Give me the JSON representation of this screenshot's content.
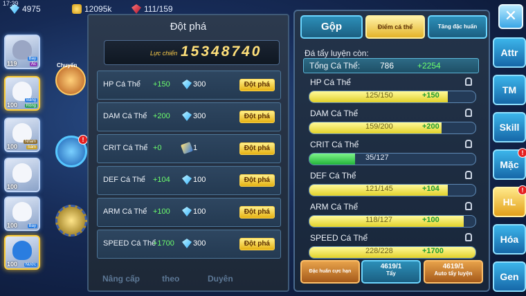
{
  "status_bar": {
    "clock": "17:39",
    "gems": "4975",
    "gold": "12095k",
    "ruby": "111/159"
  },
  "roster": [
    {
      "level": "119",
      "tag1": "Bay",
      "tag2": "Ác"
    },
    {
      "level": "100",
      "tag1": "Băng",
      "tag2": "Rồng"
    },
    {
      "level": "100",
      "tag1": "Nham",
      "tag2": "Sấm"
    },
    {
      "level": "100",
      "tag1": "",
      "tag2": ""
    },
    {
      "level": "100",
      "tag1": "Bay",
      "tag2": ""
    },
    {
      "level": "100",
      "tag1": "Nước",
      "tag2": ""
    }
  ],
  "dock": {
    "egg_label": "Chuyến"
  },
  "breakthrough_panel": {
    "title": "Đột phá",
    "power_label": "Lực chiến",
    "power_value": "15348740",
    "rows": [
      {
        "name": "HP Cá Thể",
        "bonus": "+150",
        "cost": "300",
        "cost_type": "diamond",
        "button": "Đột phá"
      },
      {
        "name": "DAM Cá Thể",
        "bonus": "+200",
        "cost": "300",
        "cost_type": "diamond",
        "button": "Đột phá"
      },
      {
        "name": "CRIT Cá Thể",
        "bonus": "+0",
        "cost": "1",
        "cost_type": "scroll",
        "button": "Đột phá"
      },
      {
        "name": "DEF Cá Thể",
        "bonus": "+104",
        "cost": "100",
        "cost_type": "diamond",
        "button": "Đột phá"
      },
      {
        "name": "ARM Cá Thể",
        "bonus": "+100",
        "cost": "100",
        "cost_type": "diamond",
        "button": "Đột phá"
      },
      {
        "name": "SPEED Cá Thể",
        "bonus": "+1700",
        "cost": "300",
        "cost_type": "diamond",
        "button": "Đột phá"
      }
    ],
    "bottom_tabs": [
      "Nâng cấp",
      "theo",
      "Duyên"
    ]
  },
  "training_panel": {
    "tab_merge": "Gộp",
    "tab_points": "Điểm cá thể",
    "tab_special": "Tăng đặc huấn",
    "remaining_label": "Đá tẩy luyện còn:",
    "total_label": "Tổng Cá Thể:",
    "total_value": "786",
    "total_bonus": "+2254",
    "bars": [
      {
        "name": "HP Cá Thể",
        "current": 125,
        "max": 150,
        "text": "125/150",
        "bonus": "+150",
        "style": "yellow"
      },
      {
        "name": "DAM Cá Thể",
        "current": 159,
        "max": 200,
        "text": "159/200",
        "bonus": "+200",
        "style": "yellow"
      },
      {
        "name": "CRIT Cá Thể",
        "current": 35,
        "max": 127,
        "text": "35/127",
        "bonus": "",
        "style": "green"
      },
      {
        "name": "DEF Cá Thể",
        "current": 121,
        "max": 145,
        "text": "121/145",
        "bonus": "+104",
        "style": "yellow"
      },
      {
        "name": "ARM Cá Thể",
        "current": 118,
        "max": 127,
        "text": "118/127",
        "bonus": "+100",
        "style": "yellow"
      },
      {
        "name": "SPEED Cá Thể",
        "current": 228,
        "max": 228,
        "text": "228/228",
        "bonus": "+1700",
        "style": "yellow"
      }
    ],
    "footer": {
      "special_training": "Đặc huấn cực hạn",
      "wash_count": "4619/1",
      "wash_label": "Tẩy",
      "auto_count": "4619/1",
      "auto_label": "Auto tẩy luyện"
    }
  },
  "side_nav": {
    "close_symbol": "✕",
    "items": [
      "Attr",
      "TM",
      "Skill",
      "Mặc",
      "HL",
      "Hóa",
      "Gen"
    ]
  }
}
